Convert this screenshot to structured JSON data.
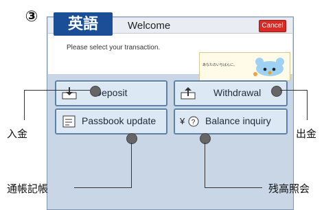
{
  "step": {
    "number": "③"
  },
  "screen": {
    "language_tab": "英語",
    "title": "Welcome",
    "cancel_label": "Cancel",
    "prompt": "Please select your transaction.",
    "banner_text": "あなたのいちばんに。",
    "buttons": {
      "deposit": "Deposit",
      "withdrawal": "Withdrawal",
      "passbook_update": "Passbook update",
      "balance_inquiry": "Balance inquiry"
    }
  },
  "annotations": {
    "deposit": "入金",
    "withdrawal": "出金",
    "passbook_update": "通帳記帳",
    "balance_inquiry": "残高照会"
  },
  "colors": {
    "tab_blue": "#1a4f97",
    "cancel_red": "#d82b25",
    "screen_bg": "#c8d6e6",
    "button_bg": "#dde8f5"
  }
}
